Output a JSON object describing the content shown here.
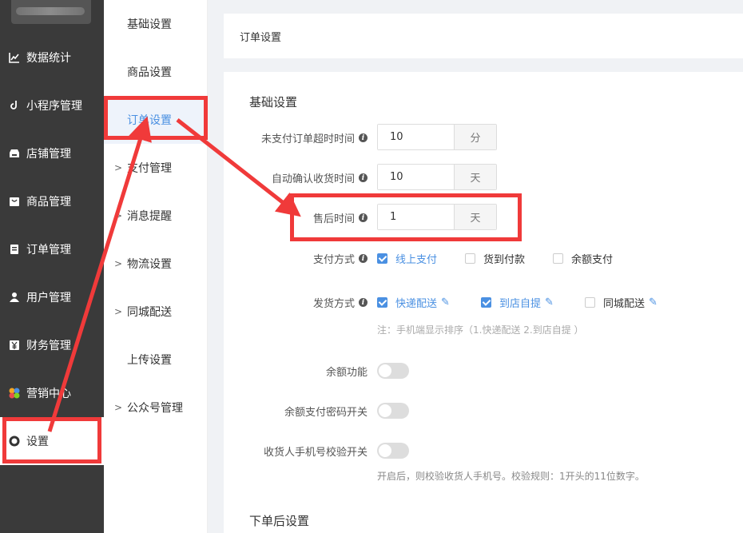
{
  "sidebar": {
    "items": [
      {
        "label": "数据统计",
        "icon": "chart-line-icon"
      },
      {
        "label": "小程序管理",
        "icon": "link-icon"
      },
      {
        "label": "店铺管理",
        "icon": "shop-icon"
      },
      {
        "label": "商品管理",
        "icon": "goods-icon"
      },
      {
        "label": "订单管理",
        "icon": "order-icon"
      },
      {
        "label": "用户管理",
        "icon": "user-icon"
      },
      {
        "label": "财务管理",
        "icon": "yen-icon"
      },
      {
        "label": "营销中心",
        "icon": "marketing-icon"
      },
      {
        "label": "设置",
        "icon": "gear-icon"
      }
    ]
  },
  "subnav": {
    "items": [
      {
        "label": "基础设置"
      },
      {
        "label": "商品设置"
      },
      {
        "label": "订单设置"
      },
      {
        "label": "支付管理"
      },
      {
        "label": "消息提醒"
      },
      {
        "label": "物流设置"
      },
      {
        "label": "同城配送"
      },
      {
        "label": "上传设置"
      },
      {
        "label": "公众号管理"
      }
    ]
  },
  "header": {
    "title": "订单设置"
  },
  "basic": {
    "title": "基础设置",
    "unpaid_timeout": {
      "label": "未支付订单超时时间",
      "value": "10",
      "unit": "分"
    },
    "auto_confirm": {
      "label": "自动确认收货时间",
      "value": "10",
      "unit": "天"
    },
    "after_sale": {
      "label": "售后时间",
      "value": "1",
      "unit": "天"
    },
    "payment": {
      "label": "支付方式",
      "options": [
        {
          "label": "线上支付",
          "checked": true
        },
        {
          "label": "货到付款",
          "checked": false
        },
        {
          "label": "余额支付",
          "checked": false
        }
      ]
    },
    "delivery": {
      "label": "发货方式",
      "options": [
        {
          "label": "快递配送",
          "checked": true
        },
        {
          "label": "到店自提",
          "checked": true
        },
        {
          "label": "同城配送",
          "checked": false
        }
      ],
      "note": "注：手机端显示排序（1.快递配送 2.到店自提 ）"
    },
    "balance_function": {
      "label": "余额功能"
    },
    "balance_pwd": {
      "label": "余额支付密码开关"
    },
    "phone_check": {
      "label": "收货人手机号校验开关",
      "note": "开启后，则校验收货人手机号。校验规则：1开头的11位数字。"
    }
  },
  "after_order": {
    "title": "下单后设置"
  },
  "colors": {
    "accent": "#4a90e2",
    "annotation": "#f03a3a",
    "sidebar_bg": "#3a3a3a"
  }
}
